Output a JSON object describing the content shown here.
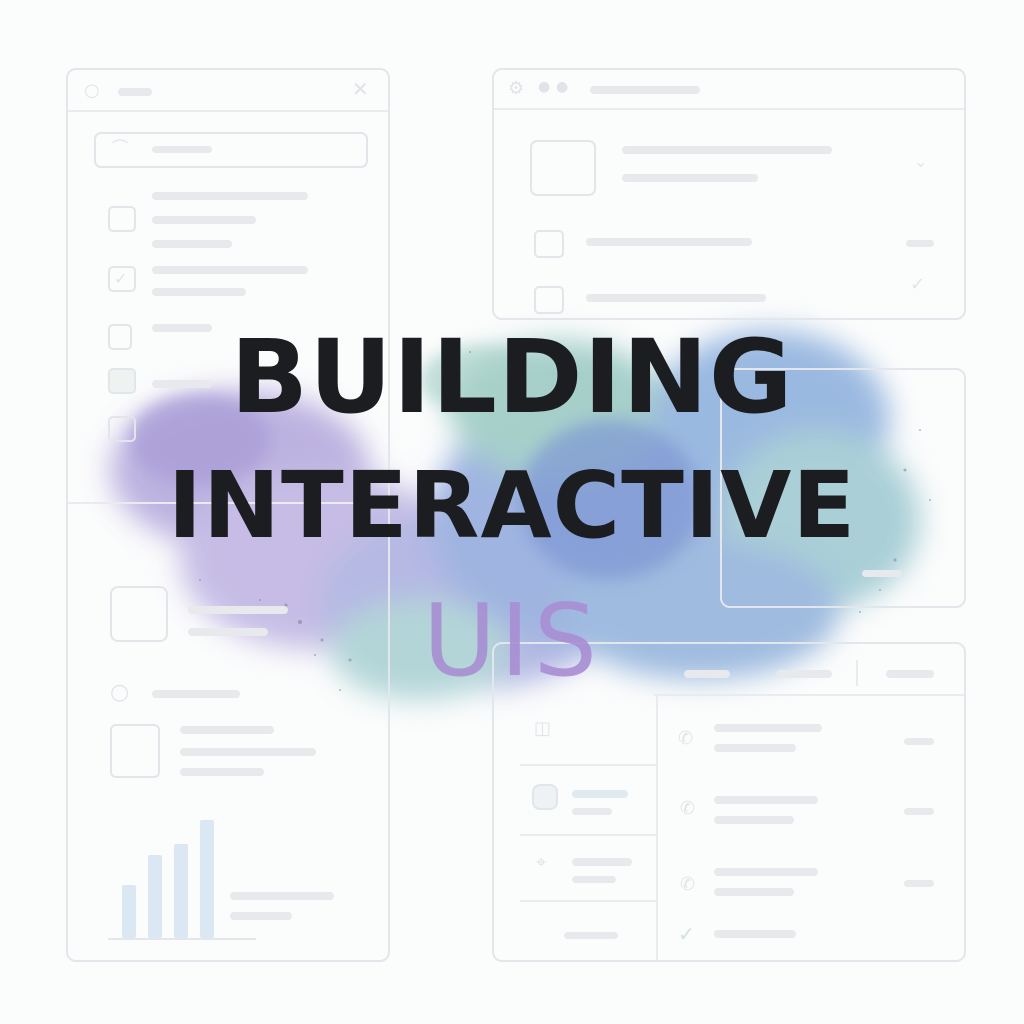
{
  "title": {
    "line1": "BUILDING",
    "line2": "INTERACTIVE",
    "line3": "UIS"
  },
  "colors": {
    "title_text": "#1c1d20",
    "accent_text": "#a98ed3",
    "wireframe": "#e3e6ea",
    "chart_bar": "#dbe8f4",
    "blob_purple": "#a9a0d8",
    "blob_blue": "#7f9fd6",
    "blob_teal": "#8fc6c0"
  },
  "chart_data": {
    "type": "bar",
    "categories": [
      "",
      "",
      "",
      ""
    ],
    "values": [
      45,
      70,
      80,
      100
    ],
    "title": "",
    "xlabel": "",
    "ylabel": ""
  },
  "icons": [
    "circle-icon",
    "close-icon",
    "search-icon",
    "checkbox-icon",
    "gear-icon",
    "phone-icon",
    "check-icon",
    "map-pin-icon",
    "avatar-icon"
  ]
}
